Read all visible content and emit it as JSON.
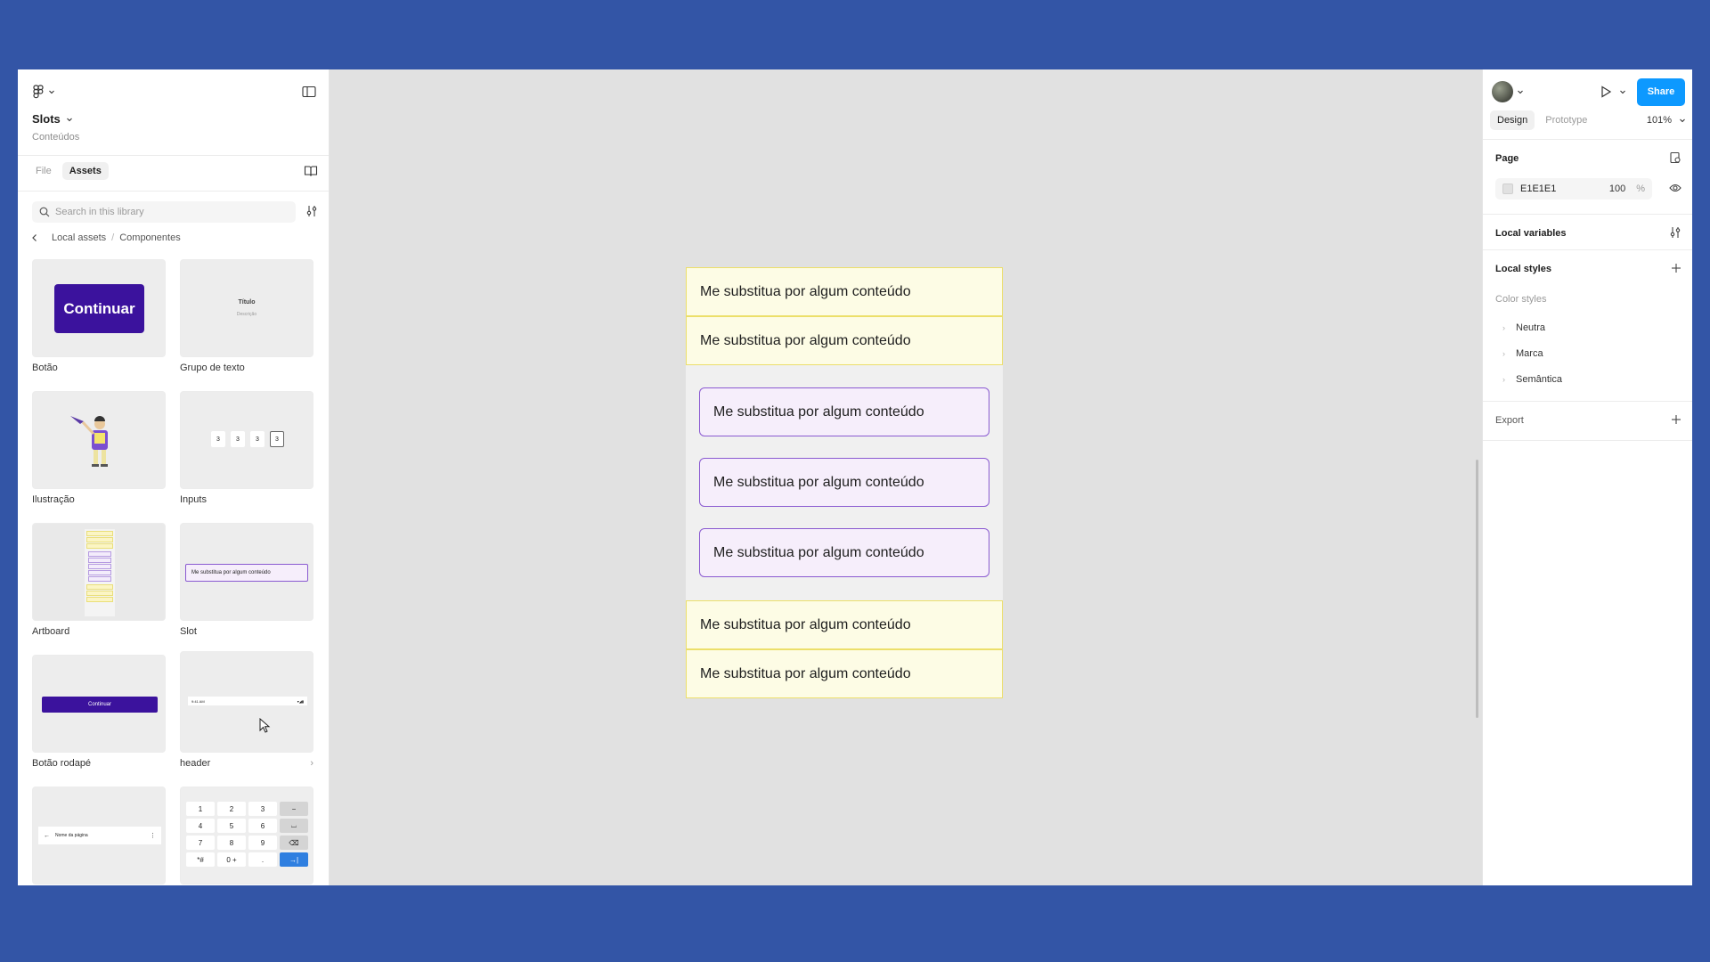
{
  "left_panel": {
    "file_title": "Slots",
    "file_subtitle": "Conteúdos",
    "tabs": [
      {
        "label": "File",
        "active": false
      },
      {
        "label": "Assets",
        "active": true
      }
    ],
    "search_placeholder": "Search in this library",
    "breadcrumb": [
      "Local assets",
      "/",
      "Componentes"
    ],
    "assets": [
      {
        "name": "Botão",
        "preview_text": "Continuar"
      },
      {
        "name": "Grupo de texto",
        "preview_title": "Título",
        "preview_desc": "Descrição"
      },
      {
        "name": "Ilustração"
      },
      {
        "name": "Inputs",
        "preview_digits": [
          "3",
          "3",
          "3",
          "3"
        ]
      },
      {
        "name": "Artboard"
      },
      {
        "name": "Slot",
        "preview_text": "Me substitua por algum conteúdo"
      },
      {
        "name": "Botão rodapé",
        "preview_text": "Continuar"
      },
      {
        "name": "header",
        "preview_time": "9:41 AM"
      },
      {
        "name": "",
        "preview_text": "Nome da página"
      },
      {
        "name": "",
        "keypad": [
          "1",
          "2",
          "3",
          "−",
          "4",
          "5",
          "6",
          "⌴",
          "7",
          "8",
          "9",
          "⌫",
          "*#",
          "0 +",
          ".",
          "→|"
        ]
      }
    ]
  },
  "canvas": {
    "rows": [
      {
        "text": "Me substitua por algum conteúdo",
        "style": "yellow"
      },
      {
        "text": "Me substitua por algum conteúdo",
        "style": "yellow"
      },
      {
        "text": "Me substitua por algum conteúdo",
        "style": "purple"
      },
      {
        "text": "Me substitua por algum conteúdo",
        "style": "purple"
      },
      {
        "text": "Me substitua por algum conteúdo",
        "style": "purple"
      },
      {
        "text": "Me substitua por algum conteúdo",
        "style": "yellow"
      },
      {
        "text": "Me substitua por algum conteúdo",
        "style": "yellow"
      }
    ]
  },
  "right_panel": {
    "share_label": "Share",
    "tabs": [
      {
        "label": "Design",
        "active": true
      },
      {
        "label": "Prototype",
        "active": false
      }
    ],
    "zoom": "101%",
    "page": {
      "title": "Page",
      "bg_hex": "E1E1E1",
      "opacity": "100",
      "opacity_unit": "%"
    },
    "local_variables": "Local variables",
    "local_styles": "Local styles",
    "color_styles_label": "Color styles",
    "color_styles": [
      "Neutra",
      "Marca",
      "Semântica"
    ],
    "export_label": "Export"
  },
  "colors": {
    "backdrop": "#3355a6",
    "share_blue": "#0d99ff",
    "slot_yellow_bg": "#fdfce5",
    "slot_yellow_border": "#ecdf6a",
    "slot_purple_bg": "#f6eefb",
    "slot_purple_border": "#8a5ad1",
    "button_purple": "#3b129d"
  }
}
